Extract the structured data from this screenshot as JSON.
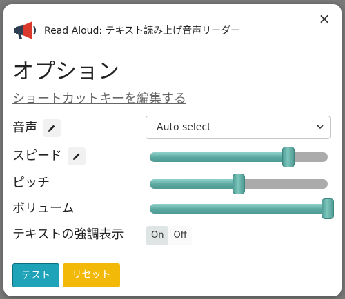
{
  "dialog": {
    "app_title": "Read Aloud: テキスト読み上げ音声リーダー",
    "close_symbol": "×",
    "page_title": "オプション",
    "shortcut_link": "ショートカットキーを編集する"
  },
  "voice": {
    "label": "音声",
    "selected": "Auto select"
  },
  "speed": {
    "label": "スピード",
    "level": 0.78
  },
  "pitch": {
    "label": "ピッチ",
    "level": 0.5
  },
  "volume": {
    "label": "ボリューム",
    "level": 1.0
  },
  "highlight": {
    "label": "テキストの強調表示",
    "on_label": "On",
    "off_label": "Off",
    "selected": "On"
  },
  "buttons": {
    "test_label": "テスト",
    "reset_label": "リセット"
  },
  "colors": {
    "accent": "#5aa8a0",
    "test_button": "#1fa3b8",
    "reset_button": "#f3b909",
    "logo_red": "#d93a2b",
    "logo_dark": "#2c3e50"
  },
  "icons": {
    "logo": "megaphone-icon",
    "close": "close-icon",
    "edit": "pencil-icon",
    "select_arrow": "chevron-down-icon"
  }
}
